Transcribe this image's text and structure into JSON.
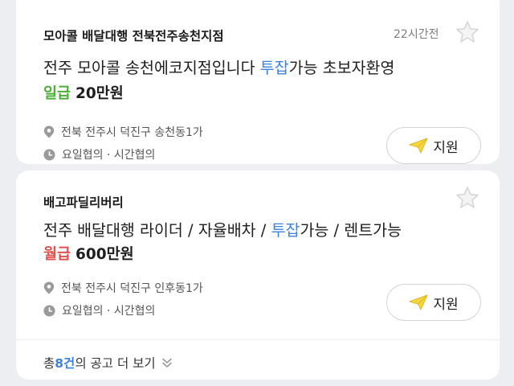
{
  "listings": [
    {
      "company": "모아콜 배달대행 전북전주송천지점",
      "posted": "22시간전",
      "title_pre": "전주 모아콜 송천에코지점입니다 ",
      "title_hl": "투잡",
      "title_post": "가능 초보자환영",
      "pay_label": "일급",
      "pay_amount": "20만원",
      "location": "전북 전주시 덕진구 송천동1가",
      "hours": "요일협의 · 시간협의",
      "apply_label": "지원"
    },
    {
      "company": "배고파딜리버리",
      "title_pre": "전주 배달대행 라이더 / 자율배차 / ",
      "title_hl": "투잡",
      "title_post": "가능 / 렌트가능",
      "pay_label": "월급",
      "pay_amount": "600만원",
      "location": "전북 전주시 덕진구 인후동1가",
      "hours": "요일협의 · 시간협의",
      "apply_label": "지원"
    }
  ],
  "more": {
    "prefix": "총 ",
    "count": "8건",
    "suffix": "의 공고 더 보기"
  },
  "colors": {
    "highlight": "#3b82e0",
    "daily_pay": "#4caf37",
    "monthly_pay": "#e0514e",
    "apply_icon": "#f5d63d"
  },
  "icons": [
    "star-icon",
    "location-pin-icon",
    "clock-icon",
    "paper-plane-icon",
    "double-chevron-down-icon"
  ]
}
